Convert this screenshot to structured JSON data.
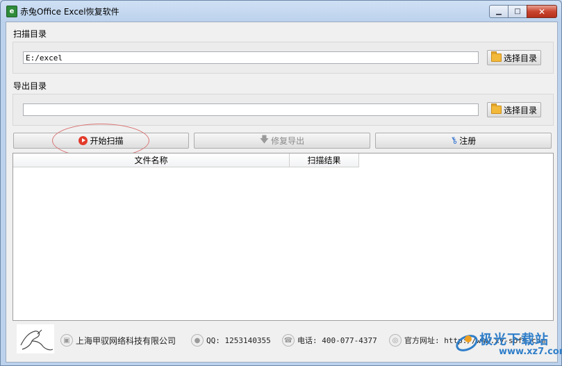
{
  "window": {
    "title": "赤兔Office Excel恢复软件",
    "app_icon": "e",
    "minimize_glyph": "▁",
    "maximize_glyph": "□",
    "close_glyph": "✕"
  },
  "scan_dir": {
    "label": "扫描目录",
    "value": "E:/excel",
    "choose_label": "选择目录"
  },
  "export_dir": {
    "label": "导出目录",
    "value": "",
    "choose_label": "选择目录"
  },
  "actions": {
    "start_scan": "开始扫描",
    "repair_export": "修复导出",
    "register": "注册"
  },
  "table": {
    "columns": [
      "文件名称",
      "扫描结果"
    ],
    "rows": []
  },
  "footer": {
    "company": "上海甲驭网络科技有限公司",
    "qq": "QQ: 1253140355",
    "phone": "电话: 400-077-4377",
    "website": "官方网址: http://www.xy-soft.com"
  },
  "watermark": {
    "text": "极光下载站",
    "url": "www.xz7.com"
  },
  "colors": {
    "accent_blue": "#2f7ec9",
    "play_red": "#e23b2a",
    "highlight_ellipse": "#d97272"
  }
}
